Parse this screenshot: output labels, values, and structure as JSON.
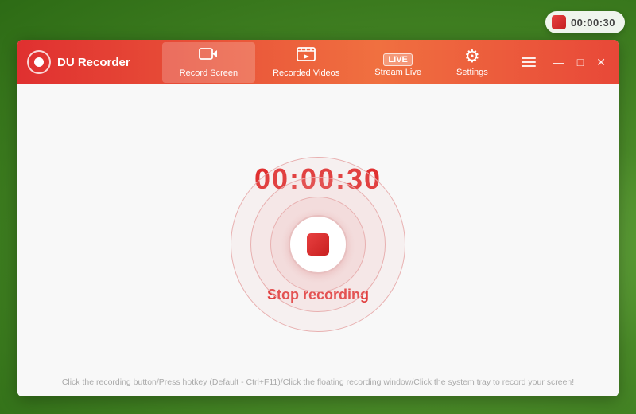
{
  "app": {
    "title": "DU Recorder"
  },
  "floating_timer": {
    "time": "00:00:30"
  },
  "nav": {
    "items": [
      {
        "id": "record-screen",
        "label": "Record Screen",
        "active": true
      },
      {
        "id": "recorded-videos",
        "label": "Recorded Videos",
        "active": false
      },
      {
        "id": "stream-live",
        "label": "Stream Live",
        "active": false
      },
      {
        "id": "settings",
        "label": "Settings",
        "active": false
      }
    ]
  },
  "main": {
    "timer": "00:00:30",
    "stop_label": "Stop recording",
    "hint": "Click the recording button/Press hotkey (Default - Ctrl+F11)/Click the floating recording window/Click the system tray to record your screen!"
  },
  "window_controls": {
    "menu": "☰",
    "minimize": "—",
    "maximize": "□",
    "close": "✕"
  }
}
